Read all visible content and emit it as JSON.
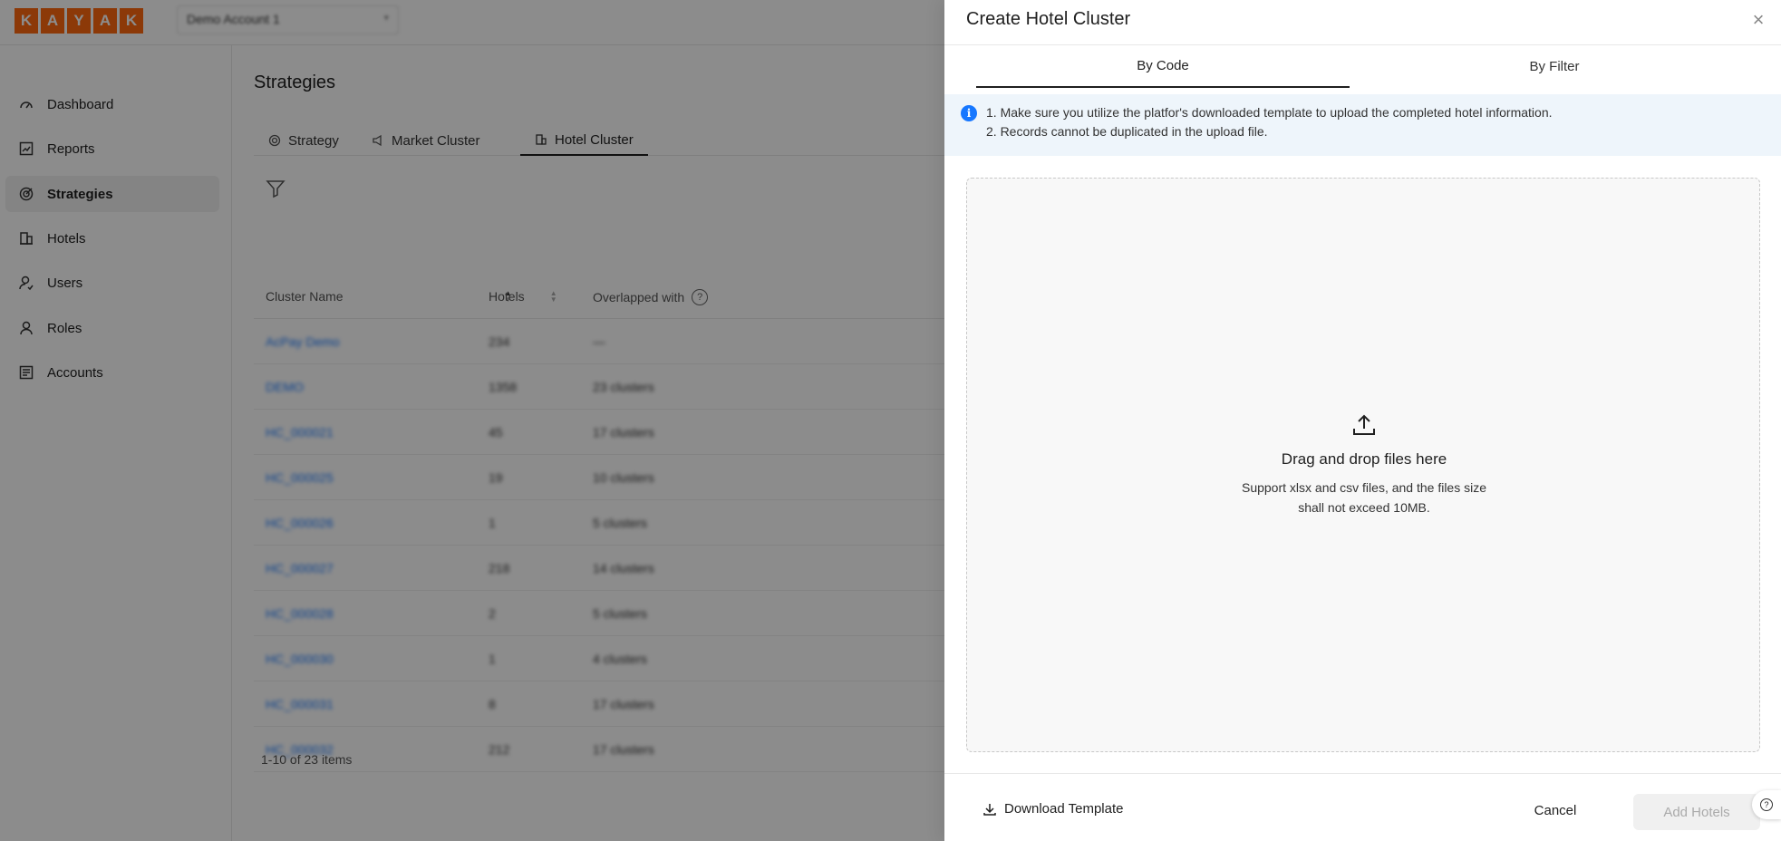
{
  "header": {
    "logo_letters": [
      "K",
      "A",
      "Y",
      "A",
      "K"
    ],
    "account_select_value": "Demo Account 1"
  },
  "sidebar": {
    "items": [
      {
        "label": "Dashboard",
        "icon": "dashboard-gauge-icon",
        "active": false
      },
      {
        "label": "Reports",
        "icon": "report-chart-icon",
        "active": false
      },
      {
        "label": "Strategies",
        "icon": "target-icon",
        "active": true
      },
      {
        "label": "Hotels",
        "icon": "building-icon",
        "active": false
      },
      {
        "label": "Users",
        "icon": "user-icon",
        "active": false
      },
      {
        "label": "Roles",
        "icon": "role-icon",
        "active": false
      },
      {
        "label": "Accounts",
        "icon": "list-icon",
        "active": false
      }
    ]
  },
  "main": {
    "title": "Strategies",
    "tabs": [
      {
        "label": "Strategy",
        "icon": "target-icon"
      },
      {
        "label": "Market Cluster",
        "icon": "megaphone-icon"
      },
      {
        "label": "Hotel Cluster",
        "icon": "building-icon"
      }
    ],
    "table": {
      "columns": [
        "Cluster Name",
        "Hotels",
        "Overlapped with"
      ],
      "rows": [
        [
          "AcPay Demo",
          "234",
          "—"
        ],
        [
          "DEMO",
          "1358",
          "23 clusters"
        ],
        [
          "HC_000021",
          "45",
          "17 clusters"
        ],
        [
          "HC_000025",
          "19",
          "10 clusters"
        ],
        [
          "HC_000026",
          "1",
          "5 clusters"
        ],
        [
          "HC_000027",
          "218",
          "14 clusters"
        ],
        [
          "HC_000028",
          "2",
          "5 clusters"
        ],
        [
          "HC_000030",
          "1",
          "4 clusters"
        ],
        [
          "HC_000031",
          "8",
          "17 clusters"
        ],
        [
          "HC_000032",
          "212",
          "17 clusters"
        ]
      ]
    },
    "pagination_text": "1-10 of 23 items"
  },
  "drawer": {
    "title": "Create Hotel Cluster",
    "close_icon": "close-icon",
    "tabs": [
      "By Code",
      "By Filter"
    ],
    "active_tab": "By Code",
    "info": [
      "1. Make sure you utilize the platfor's downloaded template to upload the completed hotel information.",
      "2. Records cannot be duplicated in the upload file."
    ],
    "dropzone": {
      "icon": "upload-icon",
      "title": "Drag and drop files here",
      "subtitle_line1": "Support xlsx and csv files, and the files size",
      "subtitle_line2": "shall not exceed 10MB."
    },
    "footer": {
      "download_label": "Download Template",
      "cancel_label": "Cancel",
      "add_label": "Add Hotels"
    }
  },
  "colors": {
    "brand": "#ff690f",
    "link": "#1677ff",
    "info_bg": "#eef5fb"
  }
}
